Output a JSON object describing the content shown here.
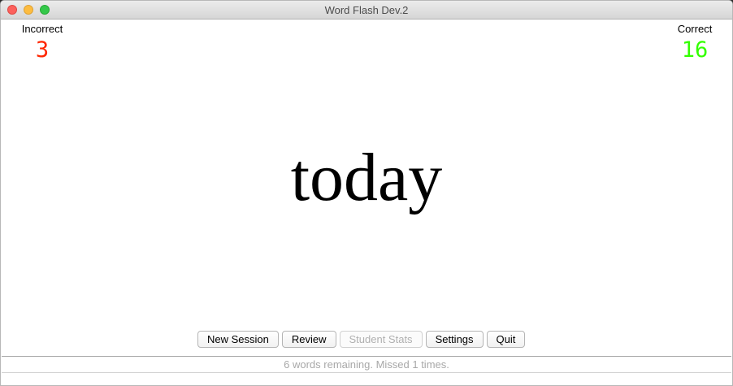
{
  "window": {
    "title": "Word Flash Dev.2"
  },
  "scores": {
    "incorrect": {
      "label": "Incorrect",
      "value": "3",
      "color": "#ff2600"
    },
    "correct": {
      "label": "Correct",
      "value": "16",
      "color": "#33ff00"
    }
  },
  "flashcard": {
    "word": "today"
  },
  "toolbar": {
    "new_session_label": "New Session",
    "review_label": "Review",
    "student_stats_label": "Student Stats",
    "settings_label": "Settings",
    "quit_label": "Quit"
  },
  "status": {
    "text": "6 words remaining. Missed 1 times."
  }
}
